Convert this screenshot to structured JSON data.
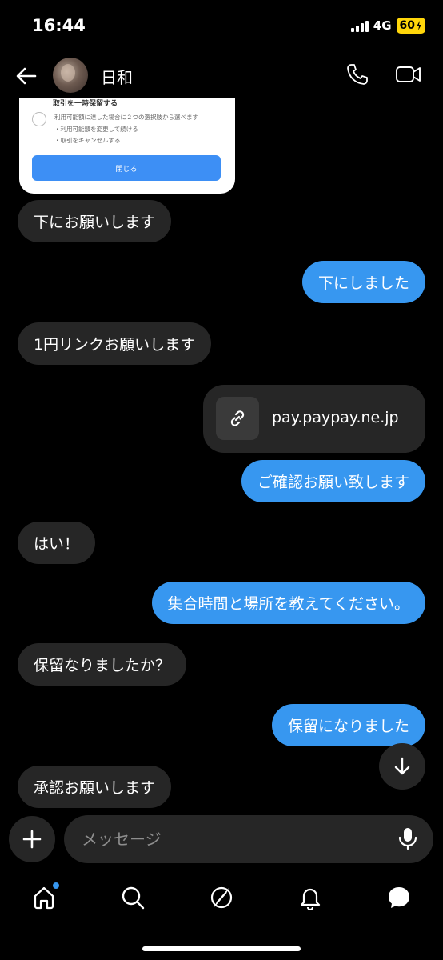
{
  "status_bar": {
    "time": "16:44",
    "network": "4G",
    "battery": "60"
  },
  "header": {
    "contact_name": "日和"
  },
  "shared_card": {
    "title": "取引を一時保留する",
    "lines": [
      "利用可能額に達した場合に２つの選択肢から選べます",
      "・利用可能額を変更して続ける",
      "・取引をキャンセルする"
    ],
    "button_label": "閉じる"
  },
  "messages": [
    {
      "direction": "in",
      "text": "下にお願いします"
    },
    {
      "direction": "out",
      "text": "下にしました"
    },
    {
      "direction": "in",
      "text": "1円リンクお願いします"
    },
    {
      "direction": "out",
      "type": "link",
      "text": "pay.paypay.ne.jp"
    },
    {
      "direction": "out",
      "text": "ご確認お願い致します"
    },
    {
      "direction": "in",
      "text": "はい！"
    },
    {
      "direction": "out",
      "text": "集合時間と場所を教えてください。"
    },
    {
      "direction": "in",
      "text": "保留なりましたか？"
    },
    {
      "direction": "out",
      "text": "保留になりました"
    },
    {
      "direction": "in",
      "text": "承認お願いします"
    }
  ],
  "composer": {
    "placeholder": "メッセージ"
  },
  "bottom_nav": {
    "items": [
      {
        "icon": "home-icon",
        "active": true
      },
      {
        "icon": "search-icon"
      },
      {
        "icon": "explore-icon"
      },
      {
        "icon": "notifications-icon"
      },
      {
        "icon": "messages-icon"
      }
    ]
  },
  "colors": {
    "accent": "#3797f0",
    "bubble_in": "#262626",
    "background": "#000000",
    "battery": "#ffd60a"
  }
}
